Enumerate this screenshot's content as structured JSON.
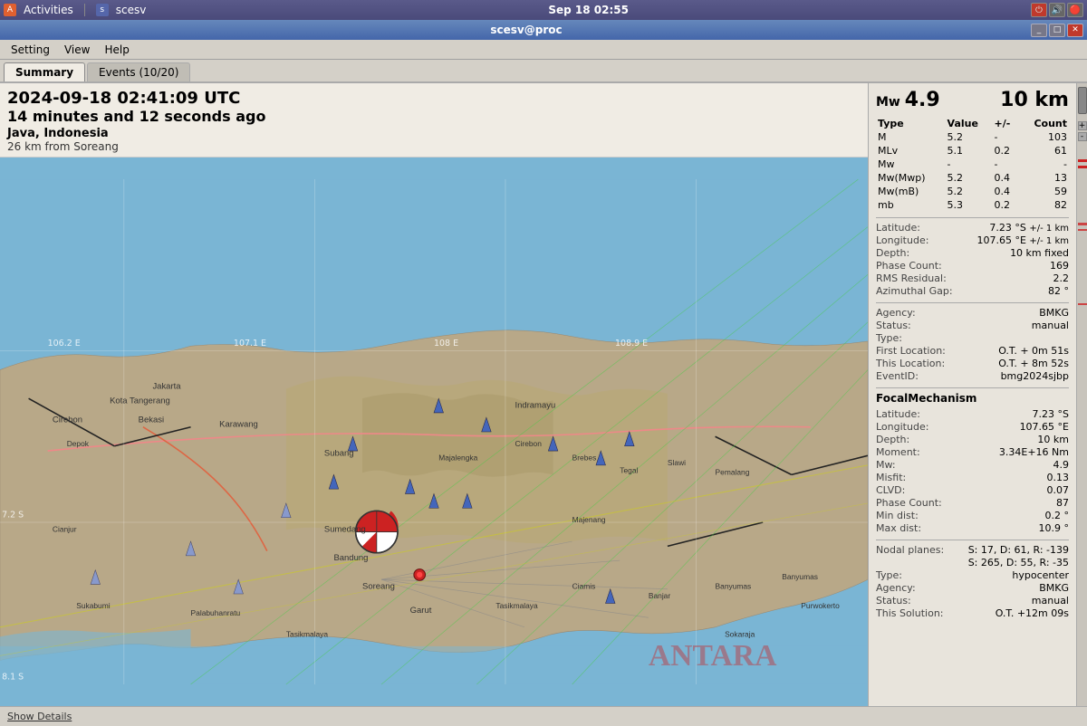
{
  "taskbar": {
    "activities_label": "Activities",
    "app_label": "scesv",
    "datetime": "Sep 18  02:55",
    "window_title": "scesv@proc"
  },
  "menu": {
    "items": [
      "Setting",
      "View",
      "Help"
    ]
  },
  "tabs": [
    {
      "label": "Summary",
      "active": true
    },
    {
      "label": "Events (10/20)",
      "active": false
    }
  ],
  "event": {
    "utc_time": "2024-09-18 02:41:09 UTC",
    "time_ago": "14 minutes and 12 seconds ago",
    "region": "Java, Indonesia",
    "distance": "26 km from Soreang"
  },
  "magnitude": {
    "label": "Mw",
    "value": "4.9",
    "depth_label": "10 km"
  },
  "magnitude_table": {
    "headers": [
      "Type",
      "Value",
      "+/-",
      "Count"
    ],
    "rows": [
      [
        "M",
        "5.2",
        "-",
        "103"
      ],
      [
        "MLv",
        "5.1",
        "0.2",
        "61"
      ],
      [
        "Mw",
        "-",
        "-",
        "-"
      ],
      [
        "Mw(Mwp)",
        "5.2",
        "0.4",
        "13"
      ],
      [
        "Mw(mB)",
        "5.2",
        "0.4",
        "59"
      ],
      [
        "mb",
        "5.3",
        "0.2",
        "82"
      ]
    ]
  },
  "location": {
    "latitude_label": "Latitude:",
    "latitude_value": "7.23 °S",
    "latitude_pm": "+/-  1 km",
    "longitude_label": "Longitude:",
    "longitude_value": "107.65 °E",
    "longitude_pm": "+/-  1 km",
    "depth_label": "Depth:",
    "depth_value": "10 km  fixed",
    "phase_count_label": "Phase Count:",
    "phase_count_value": "169",
    "rms_label": "RMS Residual:",
    "rms_value": "2.2",
    "azimuthal_label": "Azimuthal Gap:",
    "azimuthal_value": "82 °"
  },
  "event_info": {
    "agency_label": "Agency:",
    "agency_value": "BMKG",
    "status_label": "Status:",
    "status_value": "manual",
    "type_label": "Type:",
    "type_value": "",
    "first_loc_label": "First Location:",
    "first_loc_value": "O.T. + 0m 51s",
    "this_loc_label": "This Location:",
    "this_loc_value": "O.T. + 8m 52s",
    "event_id_label": "EventID:",
    "event_id_value": "bmg2024sjbp"
  },
  "focal_mechanism": {
    "title": "FocalMechanism",
    "latitude_label": "Latitude:",
    "latitude_value": "7.23 °S",
    "longitude_label": "Longitude:",
    "longitude_value": "107.65 °E",
    "depth_label": "Depth:",
    "depth_value": "10 km",
    "moment_label": "Moment:",
    "moment_value": "3.34E+16 Nm",
    "mw_label": "Mw:",
    "mw_value": "4.9",
    "misfit_label": "Misfit:",
    "misfit_value": "0.13",
    "clvd_label": "CLVD:",
    "clvd_value": "0.07",
    "phase_count_label": "Phase Count:",
    "phase_count_value": "87",
    "min_dist_label": "Min dist:",
    "min_dist_value": "0.2 °",
    "max_dist_label": "Max dist:",
    "max_dist_value": "10.9 °",
    "nodal_planes_label": "Nodal planes:",
    "nodal_planes_value1": "S: 17, D: 61, R: -139",
    "nodal_planes_value2": "S: 265, D: 55, R: -35",
    "type_label": "Type:",
    "type_value": "hypocenter",
    "agency_label": "Agency:",
    "agency_value": "BMKG",
    "status_label": "Status:",
    "status_value": "manual",
    "this_solution_label": "This Solution:",
    "this_solution_value": "O.T. +12m 09s"
  },
  "bottom_bar": {
    "show_details": "Show Details"
  },
  "map": {
    "grid_labels": [
      "106.2 E",
      "107.1 E",
      "108 E",
      "108.9 E"
    ],
    "lat_labels": [
      "7.2 S",
      "8.1 S"
    ]
  }
}
